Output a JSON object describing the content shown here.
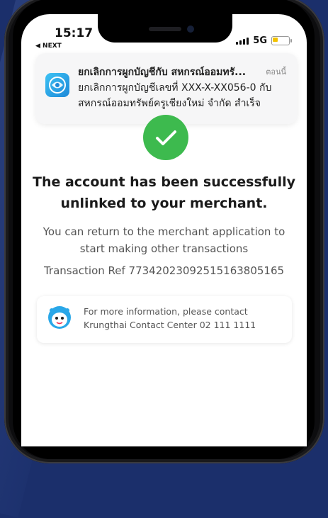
{
  "status_bar": {
    "time": "15:17",
    "back_label": "◀ NEXT",
    "network": "5G"
  },
  "notification": {
    "title": "ยกเลิกการผูกบัญชีกับ สหกรณ์ออมทรั...",
    "time": "ตอนนี้",
    "body": "ยกเลิกการผูกบัญชีเลขที่ XXX-X-XX056-0 กับ สหกรณ์ออมทรัพย์ครูเชียงใหม่ จำกัด สำเร็จ",
    "icon": "krungthai-app-icon"
  },
  "result": {
    "icon": "checkmark-icon",
    "color": "#3dba4e",
    "headline_line1": "The account has been successfully",
    "headline_line2": "unlinked to your merchant.",
    "subtext": "You can return to the merchant application to start making other transactions",
    "transaction_ref": "Transaction Ref 7734202309251516380516​5"
  },
  "info_card": {
    "icon": "mascot-icon",
    "line1": "For more information, please contact",
    "line2": "Krungthai Contact Center 02 111 1111"
  }
}
